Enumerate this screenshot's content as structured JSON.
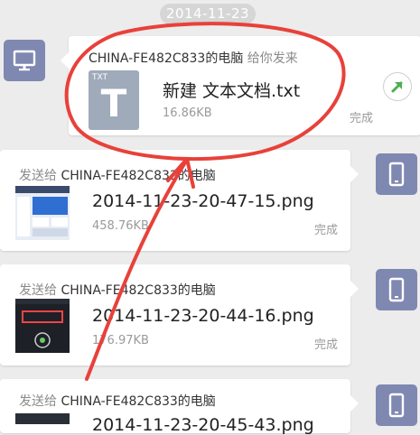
{
  "date_separator": "2014-11-23",
  "received": {
    "sender": "CHINA-FE482C833的电脑",
    "action": "给你发来",
    "file_icon_label": "TXT",
    "file_icon_letter": "T",
    "filename": "新建 文本文档.txt",
    "size": "16.86KB",
    "status": "完成"
  },
  "sent": [
    {
      "prefix": "发送给",
      "target": "CHINA-FE482C833的电脑",
      "filename": "2014-11-23-20-47-15.png",
      "size": "458.76KB",
      "status": "完成"
    },
    {
      "prefix": "发送给",
      "target": "CHINA-FE482C833的电脑",
      "filename": "2014-11-23-20-44-16.png",
      "size": "176.97KB",
      "status": "完成"
    },
    {
      "prefix": "发送给",
      "target": "CHINA-FE482C833的电脑",
      "filename": "2014-11-23-20-45-43.png",
      "size": "",
      "status": ""
    }
  ],
  "colors": {
    "avatar": "#7f88b1",
    "annotation": "#e8413a",
    "open_arrow": "#4caf50"
  },
  "icons": {
    "computer": "monitor-icon",
    "phone": "phone-icon",
    "open": "arrow-up-right-icon"
  }
}
